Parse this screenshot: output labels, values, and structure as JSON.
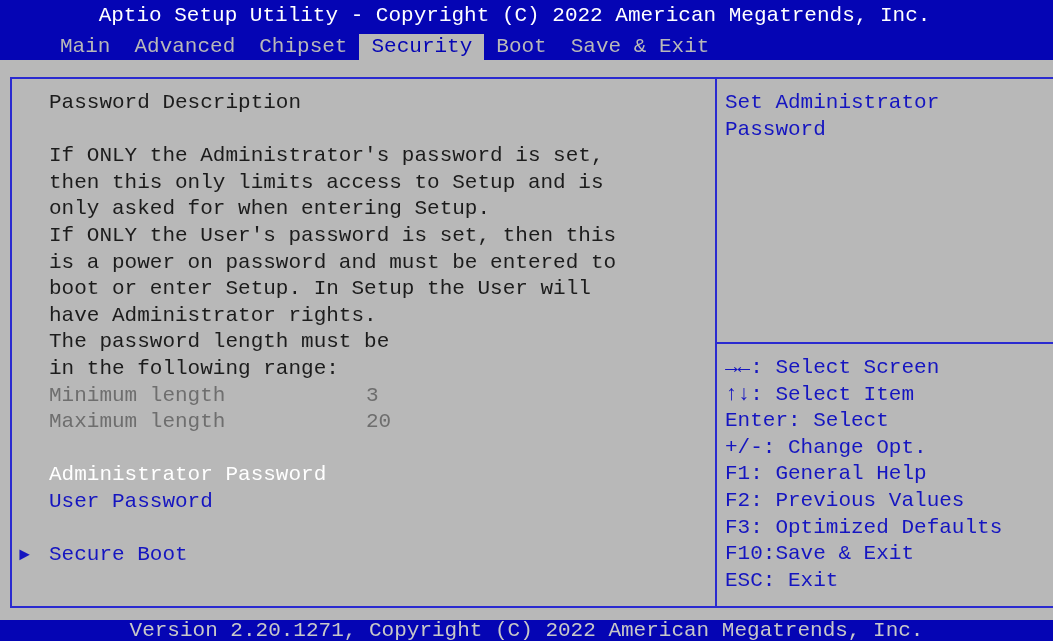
{
  "header": {
    "title": "Aptio Setup Utility - Copyright (C) 2022 American Megatrends, Inc."
  },
  "tabs": [
    {
      "label": "Main",
      "selected": false
    },
    {
      "label": "Advanced",
      "selected": false
    },
    {
      "label": "Chipset",
      "selected": false
    },
    {
      "label": "Security",
      "selected": true
    },
    {
      "label": "Boot",
      "selected": false
    },
    {
      "label": "Save & Exit",
      "selected": false
    }
  ],
  "description": {
    "heading": "Password Description",
    "lines": [
      "If ONLY the Administrator's password is set,",
      "then this only limits access to Setup and is",
      "only asked for when entering Setup.",
      "If ONLY the User's password is set, then this",
      "is a power on password and must be entered to",
      "boot or enter Setup. In Setup the User will",
      "have Administrator rights.",
      "The password length must be",
      "in the following range:"
    ]
  },
  "limits": [
    {
      "label": "Minimum length",
      "value": "3"
    },
    {
      "label": "Maximum length",
      "value": "20"
    }
  ],
  "items": [
    {
      "label": "Administrator Password",
      "selected": true
    },
    {
      "label": "User Password",
      "selected": false
    }
  ],
  "submenus": [
    {
      "label": "Secure Boot",
      "marker": "►",
      "selected": false
    }
  ],
  "help": {
    "lines": [
      "Set Administrator",
      "Password"
    ]
  },
  "keys": [
    "→←: Select Screen",
    "↑↓: Select Item",
    "Enter: Select",
    "+/-: Change Opt.",
    "F1: General Help",
    "F2: Previous Values",
    "F3: Optimized Defaults",
    "F10:Save & Exit",
    "ESC: Exit"
  ],
  "footer": "Version 2.20.1271, Copyright (C) 2022 American Megatrends, Inc."
}
